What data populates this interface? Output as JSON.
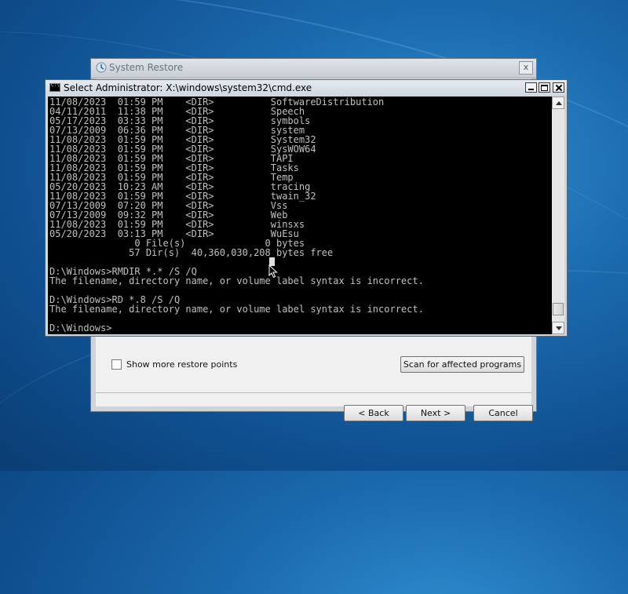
{
  "desktop": {
    "background_color": "#1b6aae"
  },
  "system_restore": {
    "title": "System Restore",
    "close_label": "x",
    "show_more_label": "Show more restore points",
    "show_more_checked": false,
    "scan_button": "Scan for affected programs",
    "back_button": "< Back",
    "next_button": "Next >",
    "cancel_button": "Cancel"
  },
  "cmd": {
    "title": "Select Administrator: X:\\windows\\system32\\cmd.exe",
    "text_color": "#c0c0c0",
    "background": "#000000",
    "scroll_position": 0.97,
    "lines": [
      "11/08/2023  01:59 PM    <DIR>          SoftwareDistribution",
      "04/11/2011  11:38 PM    <DIR>          Speech",
      "05/17/2023  03:33 PM    <DIR>          symbols",
      "07/13/2009  06:36 PM    <DIR>          system",
      "11/08/2023  01:59 PM    <DIR>          System32",
      "11/08/2023  01:59 PM    <DIR>          SysWOW64",
      "11/08/2023  01:59 PM    <DIR>          TAPI",
      "11/08/2023  01:59 PM    <DIR>          Tasks",
      "11/08/2023  01:59 PM    <DIR>          Temp",
      "05/20/2023  10:23 AM    <DIR>          tracing",
      "11/08/2023  01:59 PM    <DIR>          twain_32",
      "07/13/2009  07:20 PM    <DIR>          Vss",
      "07/13/2009  09:32 PM    <DIR>          Web",
      "11/08/2023  01:59 PM    <DIR>          winsxs",
      "05/20/2023  03:13 PM    <DIR>          WuEsu",
      "               0 File(s)              0 bytes",
      "              57 Dir(s)  40,360,030,208 bytes free",
      "",
      "D:\\Windows>RMDIR *.* /S /Q",
      "The filename, directory name, or volume label syntax is incorrect.",
      "",
      "D:\\Windows>RD *.8 /S /Q",
      "The filename, directory name, or volume label syntax is incorrect.",
      "",
      "D:\\Windows>"
    ]
  }
}
